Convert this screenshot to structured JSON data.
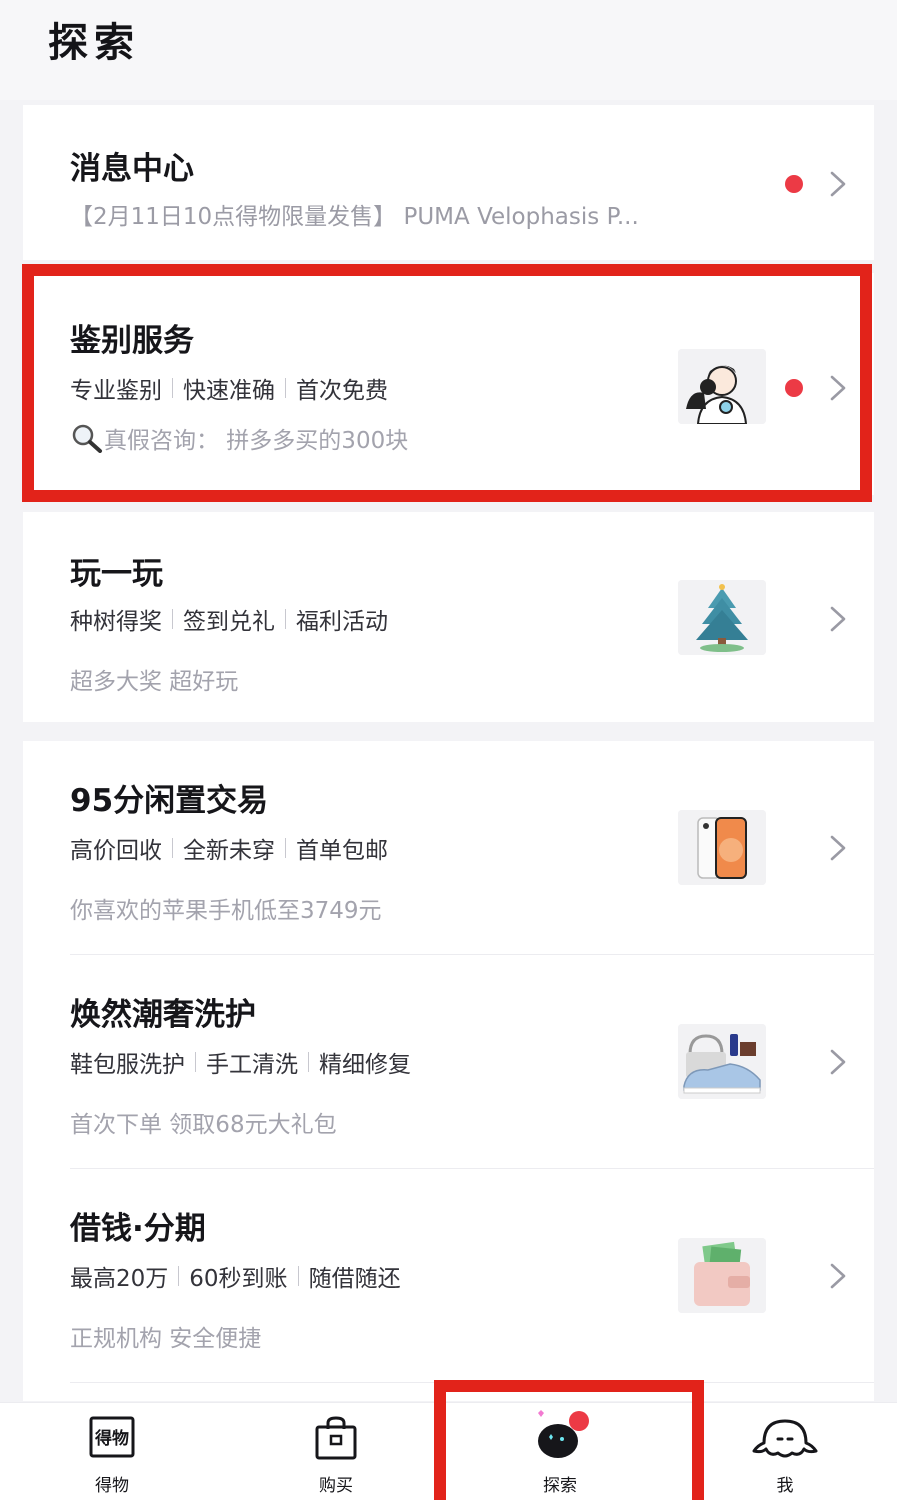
{
  "header": {
    "title": "探索"
  },
  "colors": {
    "accent_red": "#e2231a",
    "dot_red": "#ec3a45",
    "hint_gray": "#a3a3ad"
  },
  "message_center": {
    "title": "消息中心",
    "preview": "【2月11日10点得物限量发售】 PUMA Velophasis P..."
  },
  "items": [
    {
      "title": "鉴别服务",
      "tags": [
        "专业鉴别",
        "快速准确",
        "首次免费"
      ],
      "hint": "真假咨询：  拼多多买的300块",
      "hint_icon": "magnifier-icon",
      "thumb_icon": "appraiser-icon"
    },
    {
      "title": "玩一玩",
      "tags": [
        "种树得奖",
        "签到兑礼",
        "福利活动"
      ],
      "hint": "超多大奖 超好玩",
      "thumb_icon": "christmas-tree-icon"
    },
    {
      "title": "95分闲置交易",
      "tags": [
        "高价回收",
        "全新未穿",
        "首单包邮"
      ],
      "hint": "你喜欢的苹果手机低至3749元",
      "thumb_icon": "iphone-icon"
    },
    {
      "title": "焕然潮奢洗护",
      "tags": [
        "鞋包服洗护",
        "手工清洗",
        "精细修复"
      ],
      "hint": "首次下单 领取68元大礼包",
      "thumb_icon": "sneaker-bag-icon"
    },
    {
      "title": "借钱·分期",
      "tags": [
        "最高20万",
        "60秒到账",
        "随借随还"
      ],
      "hint": "正规机构 安全便捷",
      "thumb_icon": "wallet-icon"
    }
  ],
  "tabbar": {
    "tabs": [
      {
        "label": "得物",
        "icon": "dewu-logo-icon",
        "box_text": "得物"
      },
      {
        "label": "购买",
        "icon": "shopping-bag-icon"
      },
      {
        "label": "探索",
        "icon": "explore-planet-icon",
        "active": true
      },
      {
        "label": "我",
        "icon": "octopus-face-icon"
      }
    ]
  }
}
